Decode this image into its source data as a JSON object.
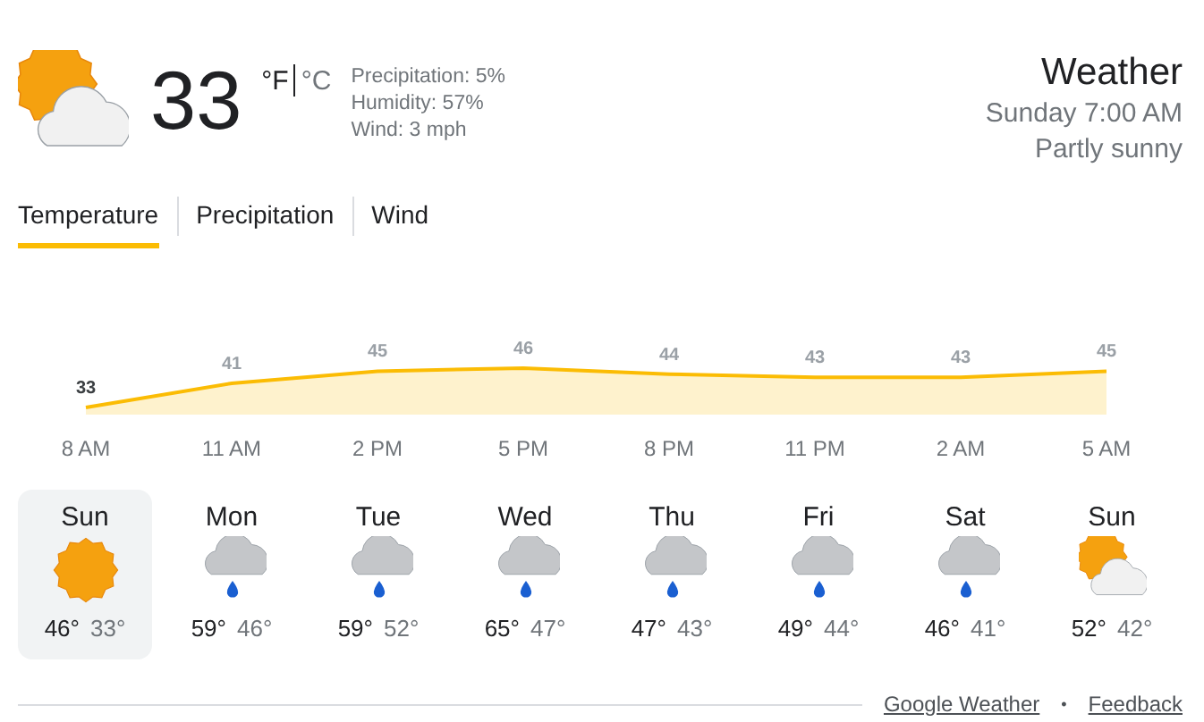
{
  "current": {
    "kind": "partly_sunny",
    "temperature": "33",
    "units": [
      {
        "label": "°F",
        "selected": true
      },
      {
        "label": "°C",
        "selected": false
      }
    ],
    "details": [
      "Precipitation: 5%",
      "Humidity: 57%",
      "Wind: 3 mph"
    ]
  },
  "header": {
    "title": "Weather",
    "time": "Sunday 7:00 AM",
    "condition": "Partly sunny"
  },
  "tabs": [
    {
      "label": "Temperature",
      "selected": true
    },
    {
      "label": "Precipitation",
      "selected": false
    },
    {
      "label": "Wind",
      "selected": false
    }
  ],
  "chart": {
    "chart_data": {
      "type": "area",
      "categories": [
        "8 AM",
        "11 AM",
        "2 PM",
        "5 PM",
        "8 PM",
        "11 PM",
        "2 AM",
        "5 AM"
      ],
      "series": [
        {
          "color": "#fbbc04",
          "values": [
            33,
            41,
            45,
            46,
            44,
            43,
            43,
            45
          ]
        }
      ],
      "data_labels": true
    }
  },
  "days": [
    {
      "day": "Sun",
      "kind": "sunny",
      "high": "46°",
      "low": "33°",
      "selected": true
    },
    {
      "day": "Mon",
      "kind": "rain",
      "high": "59°",
      "low": "46°",
      "selected": false
    },
    {
      "day": "Tue",
      "kind": "rain",
      "high": "59°",
      "low": "52°",
      "selected": false
    },
    {
      "day": "Wed",
      "kind": "rain",
      "high": "65°",
      "low": "47°",
      "selected": false
    },
    {
      "day": "Thu",
      "kind": "rain",
      "high": "47°",
      "low": "43°",
      "selected": false
    },
    {
      "day": "Fri",
      "kind": "rain",
      "high": "49°",
      "low": "44°",
      "selected": false
    },
    {
      "day": "Sat",
      "kind": "rain",
      "high": "46°",
      "low": "41°",
      "selected": false
    },
    {
      "day": "Sun",
      "kind": "partly_sunny",
      "high": "52°",
      "low": "42°",
      "selected": false
    }
  ],
  "footer": {
    "links": [
      "Google Weather",
      "Feedback"
    ],
    "separator": "•"
  }
}
